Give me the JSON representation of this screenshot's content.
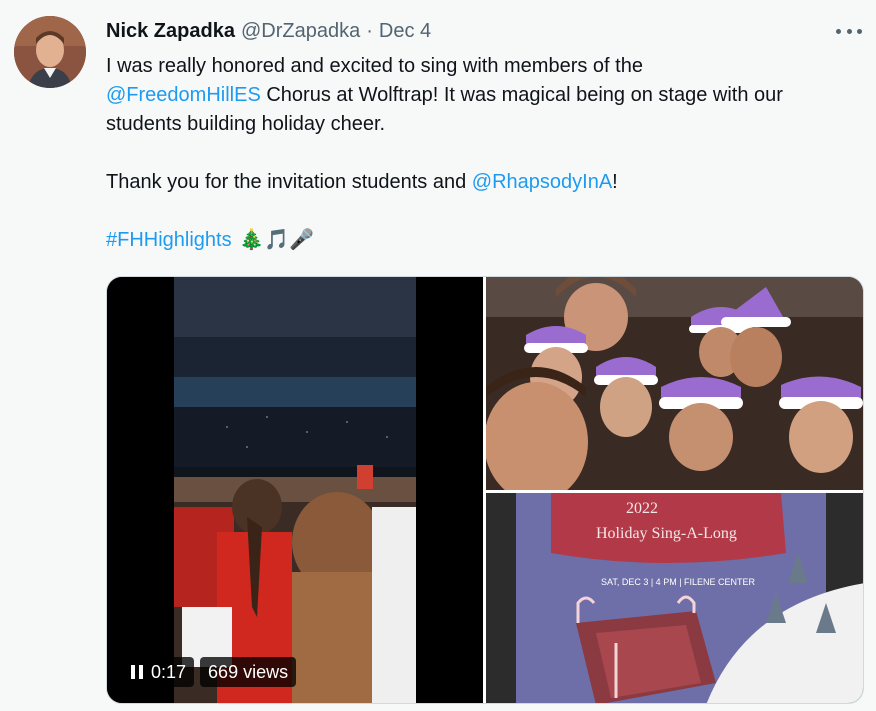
{
  "tweet": {
    "author_name": "Nick Zapadka",
    "handle": "@DrZapadka",
    "separator": "·",
    "date": "Dec 4",
    "text": {
      "line1": "I was really honored and excited to sing with members of the",
      "mention1": "@FreedomHillES",
      "line2": " Chorus at Wolftrap! It was magical being on stage with our",
      "line3": "students building holiday cheer.",
      "line4_prefix": "Thank you for the invitation students and ",
      "mention2": "@RhapsodyInA",
      "line4_suffix": "!",
      "hashtag": "#FHHighlights",
      "emojis": "🎄🎵🎤"
    }
  },
  "video": {
    "time": "0:17",
    "views": "669 views"
  },
  "program": {
    "year_line": "2022",
    "title_partial": "Holiday Sing-A-Long",
    "info": "SAT, DEC 3 | 4 PM | FILENE CENTER"
  },
  "colors": {
    "link": "#1d9bf0",
    "text": "#0f1419",
    "secondary": "#536471",
    "background": "#f7f9f9"
  }
}
